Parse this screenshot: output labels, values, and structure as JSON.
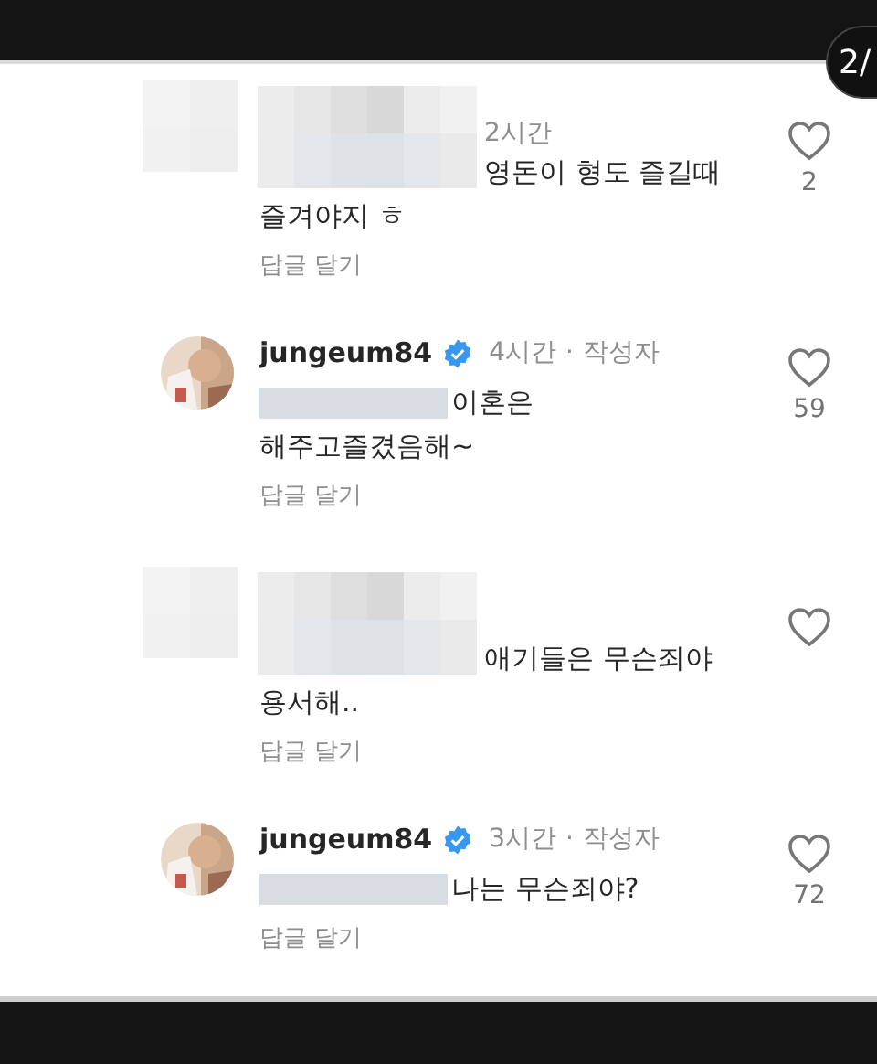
{
  "page_badge": "2/",
  "comments": [
    {
      "kind": "blurred",
      "time": "2시간",
      "lines": [
        "영돈이 형도 즐길때",
        "즐겨야지 ㅎ"
      ],
      "reply": "답글 달기",
      "liked": false,
      "likes": "2"
    },
    {
      "kind": "author",
      "username": "jungeum84",
      "verified": true,
      "time": "4시간",
      "separator": "·",
      "role": "작성자",
      "redacted_prefix": true,
      "lines": [
        "이혼은",
        "해주고즐겼음해~"
      ],
      "reply": "답글 달기",
      "liked": false,
      "likes": "59"
    },
    {
      "kind": "blurred",
      "lines": [
        "애기들은 무슨죄야",
        "용서해.."
      ],
      "reply": "답글 달기",
      "liked": false
    },
    {
      "kind": "author",
      "username": "jungeum84",
      "verified": true,
      "time": "3시간",
      "separator": "·",
      "role": "작성자",
      "redacted_prefix": true,
      "lines": [
        "나는 무슨죄야?"
      ],
      "reply": "답글 달기",
      "liked": false,
      "likes": "72"
    }
  ]
}
